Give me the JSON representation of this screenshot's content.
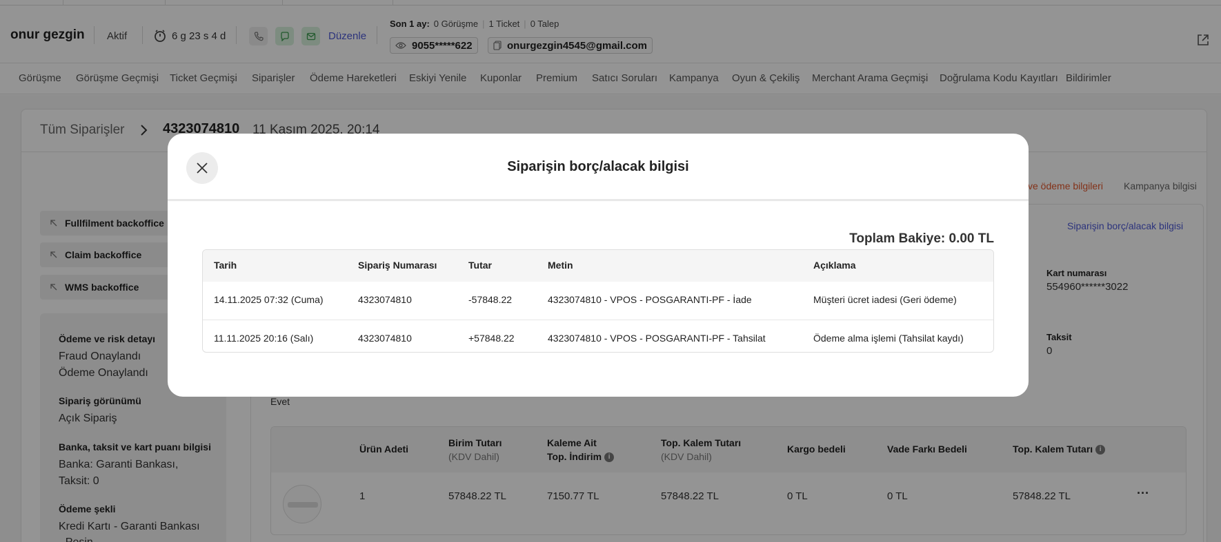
{
  "header": {
    "customer_name": "onur gezgin",
    "status": "Aktif",
    "duration": "6 g 23 s 4 d",
    "edit_label": "Düzenle",
    "last_month_label": "Son 1 ay:",
    "last_month_stats": [
      "0 Görüşme",
      "1 Ticket",
      "0 Talep"
    ],
    "phone": "9055*****622",
    "email": "onurgezgin4545@gmail.com"
  },
  "tabs": [
    "Görüşme",
    "Görüşme Geçmişi",
    "Ticket Geçmişi",
    "Siparişler",
    "Ödeme Hareketleri",
    "Eskiyi Yenile",
    "Kuponlar",
    "Premium",
    "Satıcı Soruları",
    "Kampanya",
    "Oyun & Çekiliş",
    "Merchant Arama Geçmişi",
    "Doğrulama Kodu Kayıtları",
    "Bildirimler"
  ],
  "breadcrumb": {
    "all_orders": "Tüm Siparişler",
    "order_id": "4323074810",
    "order_date": "11 Kasım 2025, 20:14"
  },
  "side_buttons": [
    "Fullfilment backoffice",
    "Claim backoffice",
    "WMS backoffice"
  ],
  "side_panel": [
    {
      "heading": "Ödeme ve risk detayı",
      "values": [
        "Fraud Onaylandı",
        "Ödeme Onaylandı"
      ]
    },
    {
      "heading": "Sipariş görünümü",
      "values": [
        "Açık Sipariş"
      ]
    },
    {
      "heading": "Banka, taksit ve kart puanı bilgisi",
      "values": [
        "Banka: Garanti Bankası,",
        "Taksit: 0"
      ]
    },
    {
      "heading": "Ödeme şekli",
      "values": [
        "Kredi Kartı - Garanti Bankası",
        "- Peşin"
      ]
    }
  ],
  "right": {
    "payment_tab": "ve ödeme bilgileri",
    "campaign_tab": "Kampanya bilgisi",
    "debt_link": "Siparişin borç/alacak bilgisi",
    "card_label": "Kart numarası",
    "card_value": "554960******3022",
    "taksit_label": "Taksit",
    "taksit_value": "0",
    "evet": "Evet"
  },
  "product_table": {
    "headers": [
      {
        "main": "Ürün Adeti",
        "sub": ""
      },
      {
        "main": "Birim Tutarı",
        "sub": "(KDV Dahil)"
      },
      {
        "main": "Kaleme Ait",
        "sub": "Top. İndirim"
      },
      {
        "main": "Top. Kalem Tutarı",
        "sub": "(KDV Dahil)"
      },
      {
        "main": "Kargo bedeli",
        "sub": ""
      },
      {
        "main": "Vade Farkı Bedeli",
        "sub": ""
      },
      {
        "main": "Top. Kalem Tutarı",
        "sub": ""
      }
    ],
    "row": [
      "1",
      "57848.22 TL",
      "7150.77 TL",
      "57848.22 TL",
      "0 TL",
      "0 TL",
      "57848.22 TL"
    ],
    "more": "···"
  },
  "modal": {
    "title": "Siparişin borç/alacak bilgisi",
    "balance": "Toplam Bakiye: 0.00 TL",
    "columns": [
      "Tarih",
      "Sipariş Numarası",
      "Tutar",
      "Metin",
      "Açıklama"
    ],
    "rows": [
      [
        "14.11.2025 07:32 (Cuma)",
        "4323074810",
        "-57848.22",
        "4323074810 - VPOS - POSGARANTI-PF - İade",
        "Müşteri ücret iadesi (Geri ödeme)"
      ],
      [
        "11.11.2025 20:16 (Salı)",
        "4323074810",
        "+57848.22",
        "4323074810 - VPOS - POSGARANTI-PF - Tahsilat",
        "Ödeme alma işlemi (Tahsilat kaydı)"
      ]
    ]
  }
}
